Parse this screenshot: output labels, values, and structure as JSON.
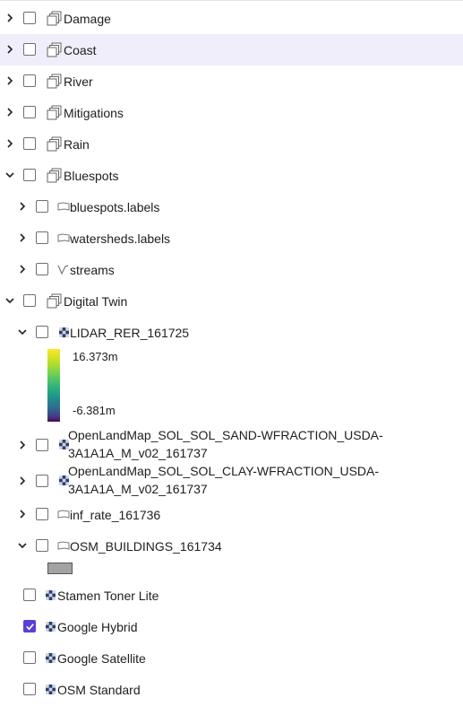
{
  "layers": [
    {
      "id": "damage",
      "label": "Damage",
      "icon": "layer-group-icon",
      "checked": false,
      "expanded": false
    },
    {
      "id": "coast",
      "label": "Coast",
      "icon": "layer-group-icon",
      "checked": false,
      "expanded": false,
      "highlighted": true
    },
    {
      "id": "river",
      "label": "River",
      "icon": "layer-group-icon",
      "checked": false,
      "expanded": false
    },
    {
      "id": "mitigations",
      "label": "Mitigations",
      "icon": "layer-group-icon",
      "checked": false,
      "expanded": false
    },
    {
      "id": "rain",
      "label": "Rain",
      "icon": "layer-group-icon",
      "checked": false,
      "expanded": false
    },
    {
      "id": "bluespots",
      "label": "Bluespots",
      "icon": "layer-group-icon",
      "checked": false,
      "expanded": true,
      "children": [
        {
          "id": "bluespots-labels",
          "label": "bluespots.labels",
          "icon": "polygon-icon",
          "checked": false
        },
        {
          "id": "watersheds-labels",
          "label": "watersheds.labels",
          "icon": "polygon-icon",
          "checked": false
        },
        {
          "id": "streams",
          "label": "streams",
          "icon": "line-icon",
          "checked": false
        }
      ]
    },
    {
      "id": "digital-twin",
      "label": "Digital Twin",
      "icon": "layer-group-icon",
      "checked": false,
      "expanded": true,
      "children": [
        {
          "id": "lidar",
          "label": "LIDAR_RER_161725",
          "icon": "raster-icon",
          "checked": false,
          "expanded": true,
          "legend": {
            "max": "16.373m",
            "min": "-6.381m"
          }
        },
        {
          "id": "sand",
          "label_line1": "OpenLandMap_SOL_SOL_SAND-WFRACTION_USDA-",
          "label_line2": "3A1A1A_M_v02_161737",
          "icon": "raster-icon",
          "checked": false
        },
        {
          "id": "clay",
          "label_line1": "OpenLandMap_SOL_SOL_CLAY-WFRACTION_USDA-",
          "label_line2": "3A1A1A_M_v02_161737",
          "icon": "raster-icon",
          "checked": false
        },
        {
          "id": "inf-rate",
          "label": "inf_rate_161736",
          "icon": "polygon-icon",
          "checked": false
        },
        {
          "id": "osm-buildings",
          "label": "OSM_BUILDINGS_161734",
          "icon": "polygon-icon",
          "checked": false,
          "expanded": true,
          "legend_color": "#a2a2a2"
        }
      ]
    }
  ],
  "basemaps": [
    {
      "id": "stamen",
      "label": "Stamen Toner Lite",
      "icon": "raster-icon",
      "checked": false
    },
    {
      "id": "google-hybrid",
      "label": "Google Hybrid",
      "icon": "raster-icon",
      "checked": true
    },
    {
      "id": "google-satellite",
      "label": "Google Satellite",
      "icon": "raster-icon",
      "checked": false
    },
    {
      "id": "osm-standard",
      "label": "OSM Standard",
      "icon": "raster-icon",
      "checked": false
    }
  ],
  "colors": {
    "accent": "#5b3fd6",
    "highlight": "#efeefa"
  }
}
